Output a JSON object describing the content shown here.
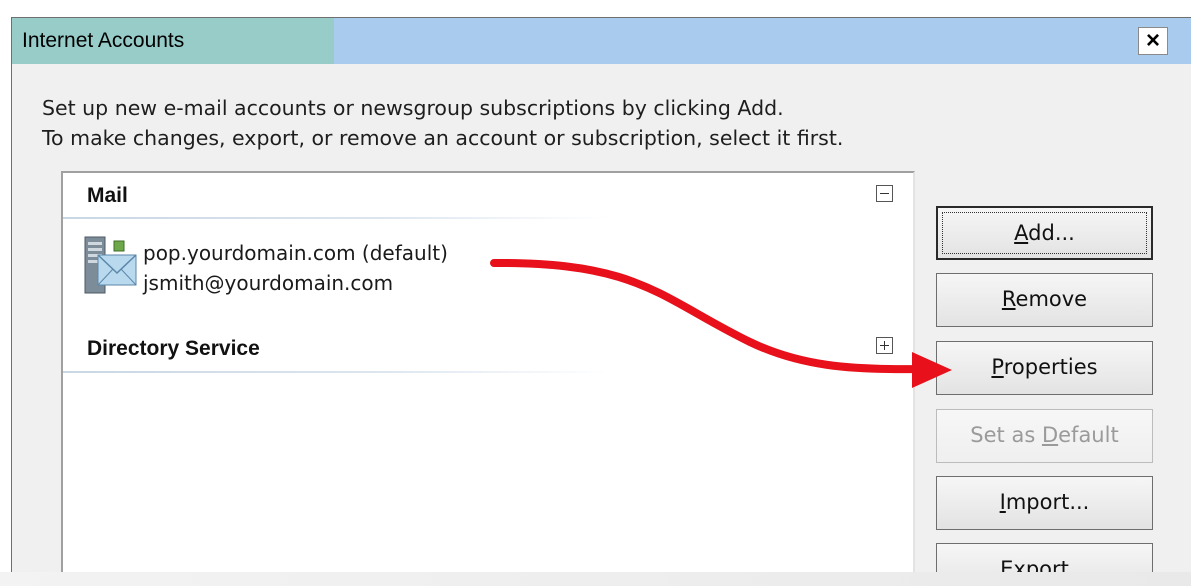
{
  "window": {
    "title": "Internet Accounts",
    "close_label": "×"
  },
  "instructions": {
    "line1": "Set up new e-mail accounts or newsgroup subscriptions by clicking Add.",
    "line2": "To make changes, export, or remove an account or subscription, select it first."
  },
  "accounts": {
    "mail_header": "Mail",
    "mail_toggle": "minus",
    "mail_account": {
      "server": "pop.yourdomain.com (default)",
      "email": "jsmith@yourdomain.com",
      "icon": "mail-server-icon"
    },
    "directory_header": "Directory Service",
    "directory_toggle": "plus"
  },
  "buttons": {
    "add": {
      "pre": "",
      "accel": "A",
      "post": "dd..."
    },
    "remove": {
      "pre": "",
      "accel": "R",
      "post": "emove"
    },
    "properties": {
      "pre": "",
      "accel": "P",
      "post": "roperties"
    },
    "set_default": {
      "pre": "Set as ",
      "accel": "D",
      "post": "efault"
    },
    "import": {
      "pre": "",
      "accel": "I",
      "post": "mport..."
    },
    "export": {
      "pre": "",
      "accel": "E",
      "post": "xport..."
    }
  },
  "colors": {
    "title_active": "#97ccc8",
    "title_bar": "#a9cbee",
    "annotation_arrow": "#e8101a"
  }
}
